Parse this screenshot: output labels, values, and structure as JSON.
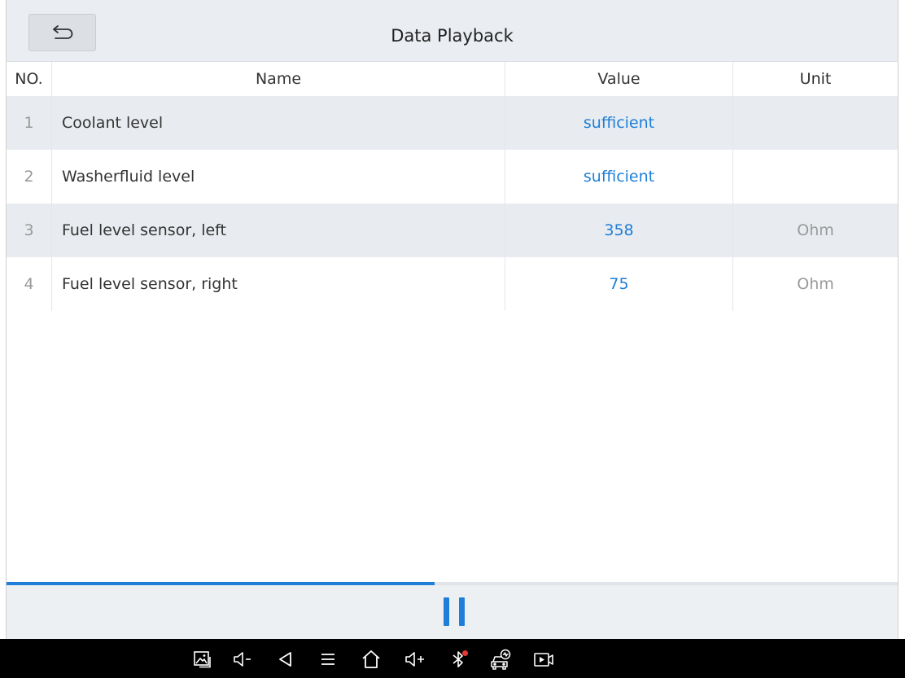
{
  "header": {
    "title": "Data Playback"
  },
  "table": {
    "columns": {
      "no": "NO.",
      "name": "Name",
      "value": "Value",
      "unit": "Unit"
    },
    "rows": [
      {
        "no": "1",
        "name": "Coolant level",
        "value": "sufficient",
        "unit": ""
      },
      {
        "no": "2",
        "name": "Washerfluid level",
        "value": "sufficient",
        "unit": ""
      },
      {
        "no": "3",
        "name": "Fuel level sensor, left",
        "value": "358",
        "unit": "Ohm"
      },
      {
        "no": "4",
        "name": "Fuel level sensor, right",
        "value": "75",
        "unit": "Ohm"
      }
    ]
  },
  "playback": {
    "progress_fraction": 0.48,
    "state": "playing"
  },
  "navbar": {
    "icons": [
      "screenshot-icon",
      "volume-down-icon",
      "back-icon",
      "menu-icon",
      "home-icon",
      "volume-up-icon",
      "bluetooth-icon",
      "vci-icon",
      "screen-record-icon"
    ]
  },
  "colors": {
    "accent": "#1e7ed8",
    "row_alt": "#e8ecf0",
    "titlebar": "#eaedf1",
    "navbar": "#000000",
    "bluetooth_badge": "#e53935"
  }
}
